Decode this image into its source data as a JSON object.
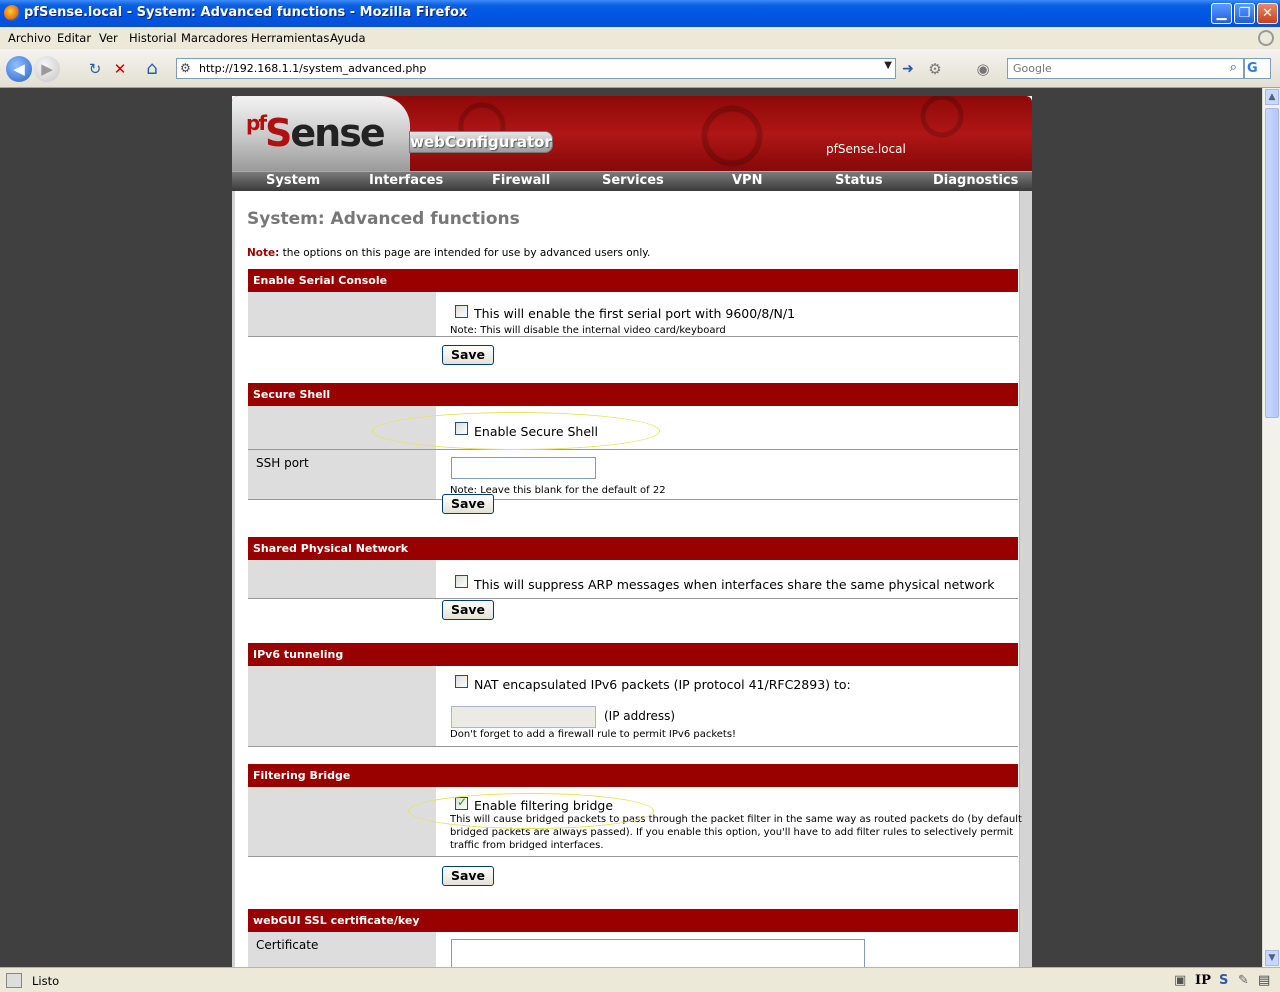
{
  "window": {
    "title": "pfSense.local - System: Advanced functions - Mozilla Firefox",
    "minimize": "▁",
    "maximize": "❐",
    "close": "✕"
  },
  "menubar": {
    "items": [
      "Archivo",
      "Editar",
      "Ver",
      "Historial",
      "Marcadores",
      "Herramientas",
      "Ayuda"
    ]
  },
  "toolbar": {
    "url": "http://192.168.1.1/system_advanced.php",
    "search_placeholder": "Google",
    "search_engine": "G",
    "back_icon": "◀",
    "fwd_icon": "▶",
    "reload_icon": "↻",
    "stop_icon": "✕",
    "home_icon": "⌂",
    "go_icon": "➜",
    "search_icon": "🔍"
  },
  "header": {
    "logo_pf": "pf",
    "logo_sense_s": "S",
    "logo_sense_rest": "ense",
    "webconfigurator": "webConfigurator",
    "hostname": "pfSense.local",
    "nav": [
      "System",
      "Interfaces",
      "Firewall",
      "Services",
      "VPN",
      "Status",
      "Diagnostics"
    ]
  },
  "page": {
    "title": "System: Advanced functions",
    "note_label": "Note:",
    "note_text": " the options on this page are intended for use by advanced users only."
  },
  "sections": {
    "serial": {
      "title": "Enable Serial Console",
      "checkbox_label": "This will enable the first serial port with 9600/8/N/1",
      "note": "Note: This will disable the internal video card/keyboard",
      "save": "Save"
    },
    "ssh": {
      "title": "Secure Shell",
      "checkbox_label": "Enable Secure Shell",
      "port_label": "SSH port",
      "port_value": "",
      "port_note": "Note: Leave this blank for the default of 22",
      "save": "Save"
    },
    "shared": {
      "title": "Shared Physical Network",
      "checkbox_label": "This will suppress ARP messages when interfaces share the same physical network",
      "save": "Save"
    },
    "ipv6": {
      "title": "IPv6 tunneling",
      "checkbox_label": "NAT encapsulated IPv6 packets (IP protocol 41/RFC2893) to:",
      "ip_suffix": "(IP address)",
      "note": "Don't forget to add a firewall rule to permit IPv6 packets!"
    },
    "bridge": {
      "title": "Filtering Bridge",
      "checkbox_label": "Enable filtering bridge",
      "checked": true,
      "note": "This will cause bridged packets to pass through the packet filter in the same way as routed packets do (by default bridged packets are always passed). If you enable this option, you'll have to add filter rules to selectively permit traffic from bridged interfaces.",
      "save": "Save"
    },
    "ssl": {
      "title": "webGUI SSL certificate/key",
      "cert_label": "Certificate"
    }
  },
  "statusbar": {
    "text": "Listo",
    "tray_ip": "IP",
    "tray_s": "S"
  },
  "colors": {
    "section_header": "#990000",
    "label_bg": "#dddddd"
  }
}
